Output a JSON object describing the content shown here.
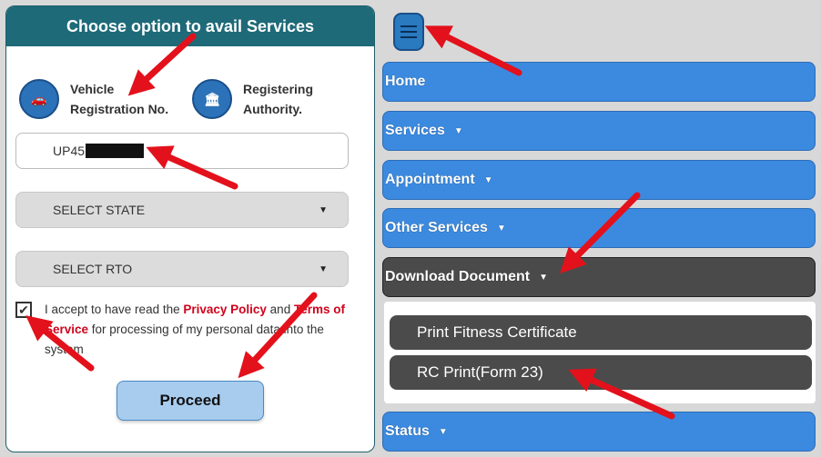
{
  "left": {
    "title": "Choose option to avail Services",
    "options": [
      {
        "line1": "Vehicle",
        "line2": "Registration No.",
        "icon": "vehicle-icon"
      },
      {
        "line1": "Registering",
        "line2": "Authority.",
        "icon": "authority-building-icon"
      }
    ],
    "registration_input": {
      "value_visible": "UP45"
    },
    "select_state": "SELECT STATE",
    "select_rto": "SELECT RTO",
    "consent": {
      "prefix": "I accept to have read the ",
      "privacy_link": "Privacy Policy",
      "middle": " and ",
      "terms_link": "Terms of Service",
      "suffix": " for processing of my personal data into the system"
    },
    "proceed_label": "Proceed"
  },
  "right": {
    "menu_items": [
      {
        "label": "Home",
        "has_caret": false
      },
      {
        "label": "Services",
        "has_caret": true
      },
      {
        "label": "Appointment",
        "has_caret": true
      },
      {
        "label": "Other Services",
        "has_caret": true
      },
      {
        "label": "Download Document",
        "has_caret": true,
        "active": true
      },
      {
        "label": "Status",
        "has_caret": true
      }
    ],
    "submenu": [
      "Print Fitness Certificate",
      "RC Print(Form 23)"
    ]
  },
  "colors": {
    "header_teal": "#1e6a78",
    "menu_blue": "#3b8ae0",
    "active_dark": "#4a4a4a",
    "arrow_red": "#e3111b",
    "link_red": "#d0021b"
  }
}
